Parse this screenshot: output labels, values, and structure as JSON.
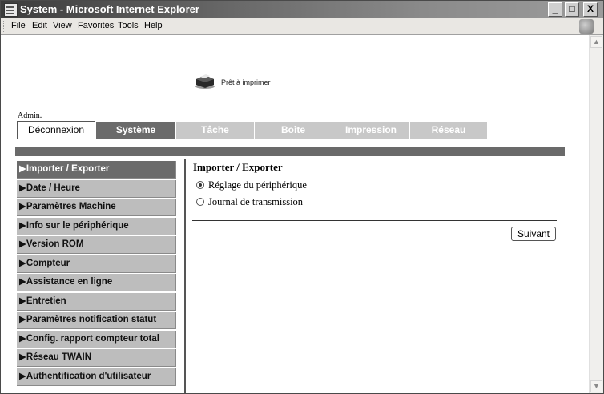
{
  "window": {
    "title": "System - Microsoft Internet Explorer",
    "buttons": {
      "minimize": "_",
      "maximize": "□",
      "close": "X"
    }
  },
  "menu": [
    "File",
    "Edit",
    "View",
    "Favorites",
    "Tools",
    "Help"
  ],
  "status": {
    "icon": "printer-icon",
    "text": "Prêt à imprimer"
  },
  "user": {
    "label": "Admin."
  },
  "tabs": {
    "logout": "Déconnexion",
    "items": [
      {
        "label": "Système",
        "active": true
      },
      {
        "label": "Tâche",
        "active": false
      },
      {
        "label": "Boîte",
        "active": false
      },
      {
        "label": "Impression",
        "active": false
      },
      {
        "label": "Réseau",
        "active": false
      }
    ]
  },
  "sidebar": {
    "items": [
      {
        "label": "▶Importer / Exporter",
        "active": true
      },
      {
        "label": "▶Date / Heure",
        "active": false
      },
      {
        "label": "▶Paramètres Machine",
        "active": false
      },
      {
        "label": "▶Info sur le périphérique",
        "active": false
      },
      {
        "label": "▶Version ROM",
        "active": false
      },
      {
        "label": "▶Compteur",
        "active": false
      },
      {
        "label": "▶Assistance en ligne",
        "active": false
      },
      {
        "label": "▶Entretien",
        "active": false
      },
      {
        "label": "▶Paramètres notification statut",
        "active": false
      },
      {
        "label": "▶Config. rapport compteur total",
        "active": false
      },
      {
        "label": "▶Réseau TWAIN",
        "active": false
      },
      {
        "label": "▶Authentification d'utilisateur",
        "active": false
      }
    ]
  },
  "main": {
    "title": "Importer / Exporter",
    "options": [
      {
        "label": "Réglage du périphérique",
        "selected": true
      },
      {
        "label": "Journal de transmission",
        "selected": false
      }
    ],
    "next_button": "Suivant"
  },
  "colors": {
    "active_tab": "#6b6b6b",
    "inactive_tab": "#c8c8c8",
    "sidebar_item": "#bdbdbd",
    "band": "#6a6a6a"
  }
}
